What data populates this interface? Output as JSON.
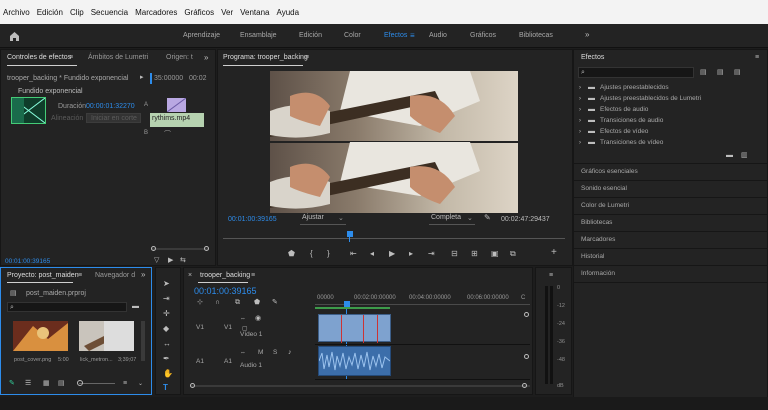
{
  "menu": [
    "Archivo",
    "Edición",
    "Clip",
    "Secuencia",
    "Marcadores",
    "Gráficos",
    "Ver",
    "Ventana",
    "Ayuda"
  ],
  "workspaces": [
    "Aprendizaje",
    "Ensamblaje",
    "Edición",
    "Color",
    "Efectos",
    "Audio",
    "Gráficos",
    "Bibliotecas"
  ],
  "active_workspace": "Efectos",
  "effect_controls": {
    "tabs": [
      "Controles de efectos",
      "Ámbitos de Lumetri",
      "Origen: t"
    ],
    "clip_path": "trooper_backing * Fundido exponencial",
    "ruler_time": "35:00000",
    "ruler_time2": "00:02",
    "effect_name": "Fundido exponencial",
    "duration_label": "Duración",
    "duration_value": "00:00:01:32270",
    "alignment_label": "Alineación",
    "alignment_value": "Iniciar en corte",
    "clip_name": "rythims.mp4",
    "marker_a": "A",
    "marker_b": "B",
    "timecode": "00:01:00:39165"
  },
  "program": {
    "title": "Programa: trooper_backing",
    "timecode": "00:01:00:39165",
    "zoom": "Ajustar",
    "quality": "Completa",
    "duration": "00:02:47:29437"
  },
  "project": {
    "tabs": [
      "Proyecto: post_maiden",
      "Navegador d"
    ],
    "file": "post_maiden.prproj",
    "items": [
      {
        "name": "post_cover.png",
        "duration": "5:00"
      },
      {
        "name": "lick_metron...",
        "duration": "3;39;07"
      }
    ]
  },
  "timeline": {
    "title": "trooper_backing",
    "timecode": "00:01:00:39165",
    "ruler": [
      "00000",
      "00:02:00:00000",
      "00:04:00:00000",
      "00:06:00:00000"
    ],
    "ruler_end": "C",
    "tracks": [
      {
        "id": "V1",
        "target": "V1",
        "name": "Vídeo 1",
        "kind": "video"
      },
      {
        "id": "A1",
        "target": "A1",
        "name": "Audio 1",
        "kind": "audio"
      }
    ],
    "track_m": "M",
    "track_s": "S"
  },
  "effects_panel": {
    "title": "Efectos",
    "folders": [
      "Ajustes preestablecidos",
      "Ajustes preestablecidos de Lumetri",
      "Efectos de audio",
      "Transiciones de audio",
      "Efectos de vídeo",
      "Transiciones de vídeo"
    ],
    "sections": [
      "Gráficos esenciales",
      "Sonido esencial",
      "Color de Lumetri",
      "Bibliotecas",
      "Marcadores",
      "Historial",
      "Información"
    ]
  },
  "meter": {
    "labels": [
      "0",
      "-12",
      "-24",
      "-36",
      "-48"
    ],
    "bottom": "dB"
  }
}
